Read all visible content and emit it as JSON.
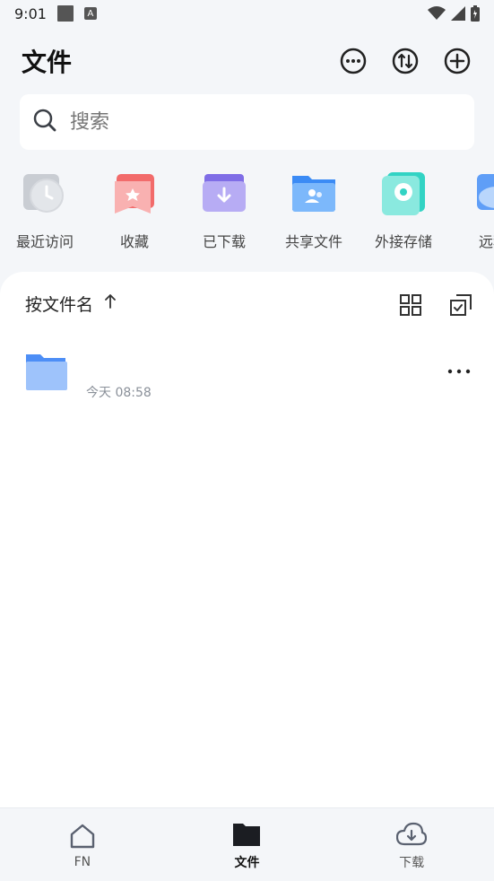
{
  "status": {
    "time": "9:01",
    "a_badge": "A"
  },
  "header": {
    "title": "文件"
  },
  "search": {
    "placeholder": "搜索"
  },
  "quick": [
    {
      "label": "最近访问",
      "icon": "clock-icon"
    },
    {
      "label": "收藏",
      "icon": "star-bookmark-icon"
    },
    {
      "label": "已下载",
      "icon": "download-folder-icon"
    },
    {
      "label": "共享文件",
      "icon": "shared-folder-icon"
    },
    {
      "label": "外接存储",
      "icon": "external-drive-icon"
    },
    {
      "label": "远程",
      "icon": "cloud-icon"
    }
  ],
  "list": {
    "sort_label": "按文件名",
    "items": [
      {
        "name": "",
        "meta": "今天 08:58"
      }
    ]
  },
  "nav": {
    "items": [
      {
        "label": "FN"
      },
      {
        "label": "文件"
      },
      {
        "label": "下载"
      }
    ]
  },
  "colors": {
    "accent_blue": "#3b8bf5",
    "panel_bg": "#ffffff",
    "page_bg": "#f4f6f9"
  }
}
